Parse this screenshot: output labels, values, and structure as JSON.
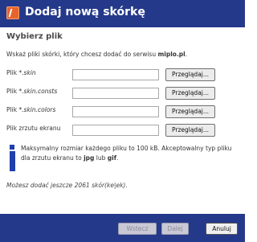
{
  "window": {
    "title": "Dodaj nową skórkę"
  },
  "section": {
    "title": "Wybierz plik"
  },
  "instructions": {
    "prefix": "Wskaż pliki skórki, który chcesz dodać do serwisu ",
    "site": "miplo.pl",
    "suffix": "."
  },
  "rows": [
    {
      "label_prefix": "Plik ",
      "label_italic": "*.skin",
      "value": "",
      "button": "Przeglądaj..."
    },
    {
      "label_prefix": "Plik ",
      "label_italic": "*.skin.consts",
      "value": "",
      "button": "Przeglądaj..."
    },
    {
      "label_prefix": "Plik ",
      "label_italic": "*.skin.colors",
      "value": "",
      "button": "Przeglądaj..."
    },
    {
      "label_prefix": "Plik zrzutu ekranu",
      "label_italic": "",
      "value": "",
      "button": "Przeglądaj..."
    }
  ],
  "info": {
    "part1": "Maksymalny rozmiar każdego pliku to 100 kB. Akceptowalny typ pliku dla zrzutu ekranu to ",
    "jpg": "jpg",
    "part2": " lub ",
    "gif": "gif",
    "part3": "."
  },
  "remaining": {
    "text": "Możesz dodać jeszcze 2061 skór(ke|ek)."
  },
  "buttons": {
    "back": "Wstecz",
    "next": "Dalej",
    "cancel": "Anuluj"
  },
  "colors": {
    "titlebar": "#25398a",
    "accent_icon": "#e8642d",
    "info_icon": "#1f3faa"
  },
  "icons": {
    "app": "miplo-logo-icon",
    "info": "info-icon"
  }
}
